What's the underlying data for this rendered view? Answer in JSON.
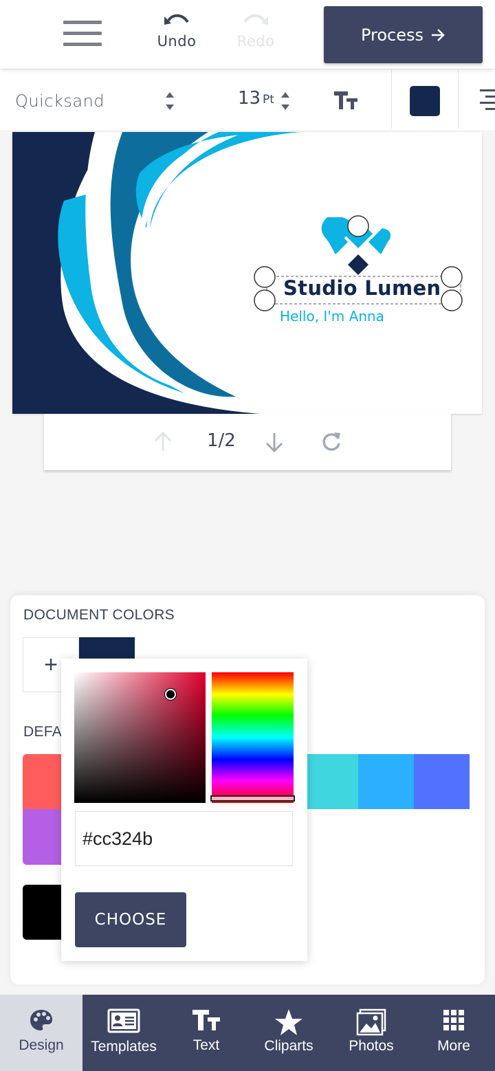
{
  "topbar": {
    "menu_icon": "hamburger-menu-icon",
    "undo_label": "Undo",
    "redo_label": "Redo",
    "process_label": "Process",
    "process_icon": "arrow-right-icon"
  },
  "format_toolbar": {
    "font_family": "Quicksand",
    "font_size": "13",
    "font_size_unit": "Pt",
    "text_case_icon": "text-size-icon",
    "text_color": "#13274f",
    "align_icon": "align-right-icon"
  },
  "design": {
    "company": "Studio Lumen",
    "greeting": "Hello, I'm Anna",
    "colors": {
      "navy": "#13274f",
      "mid_blue": "#0d6e9e",
      "cyan": "#0cb3e3"
    }
  },
  "pager": {
    "page_indicator": "1/2",
    "prev_icon": "arrow-up-icon",
    "next_icon": "arrow-down-icon",
    "rotate_icon": "refresh-icon"
  },
  "colors_panel": {
    "document_colors_title": "DOCUMENT COLORS",
    "add_label": "+",
    "document_colors": [
      "#13274f"
    ],
    "defaults_title": "DEFA",
    "default_colors_row1": [
      "#ff5c5c",
      "#3fd6e0",
      "#2bb0ff",
      "#5172ff"
    ],
    "default_colors_row2": [
      "#b460e6"
    ],
    "default_colors_row3": [
      "#000000"
    ]
  },
  "picker": {
    "hex_value": "#cc324b",
    "choose_label": "CHOOSE"
  },
  "bottom_nav": {
    "items": [
      {
        "label": "Design",
        "icon": "palette-icon"
      },
      {
        "label": "Templates",
        "icon": "id-card-icon"
      },
      {
        "label": "Text",
        "icon": "text-icon"
      },
      {
        "label": "Cliparts",
        "icon": "star-icon"
      },
      {
        "label": "Photos",
        "icon": "image-icon"
      },
      {
        "label": "More",
        "icon": "grid-icon"
      }
    ]
  }
}
